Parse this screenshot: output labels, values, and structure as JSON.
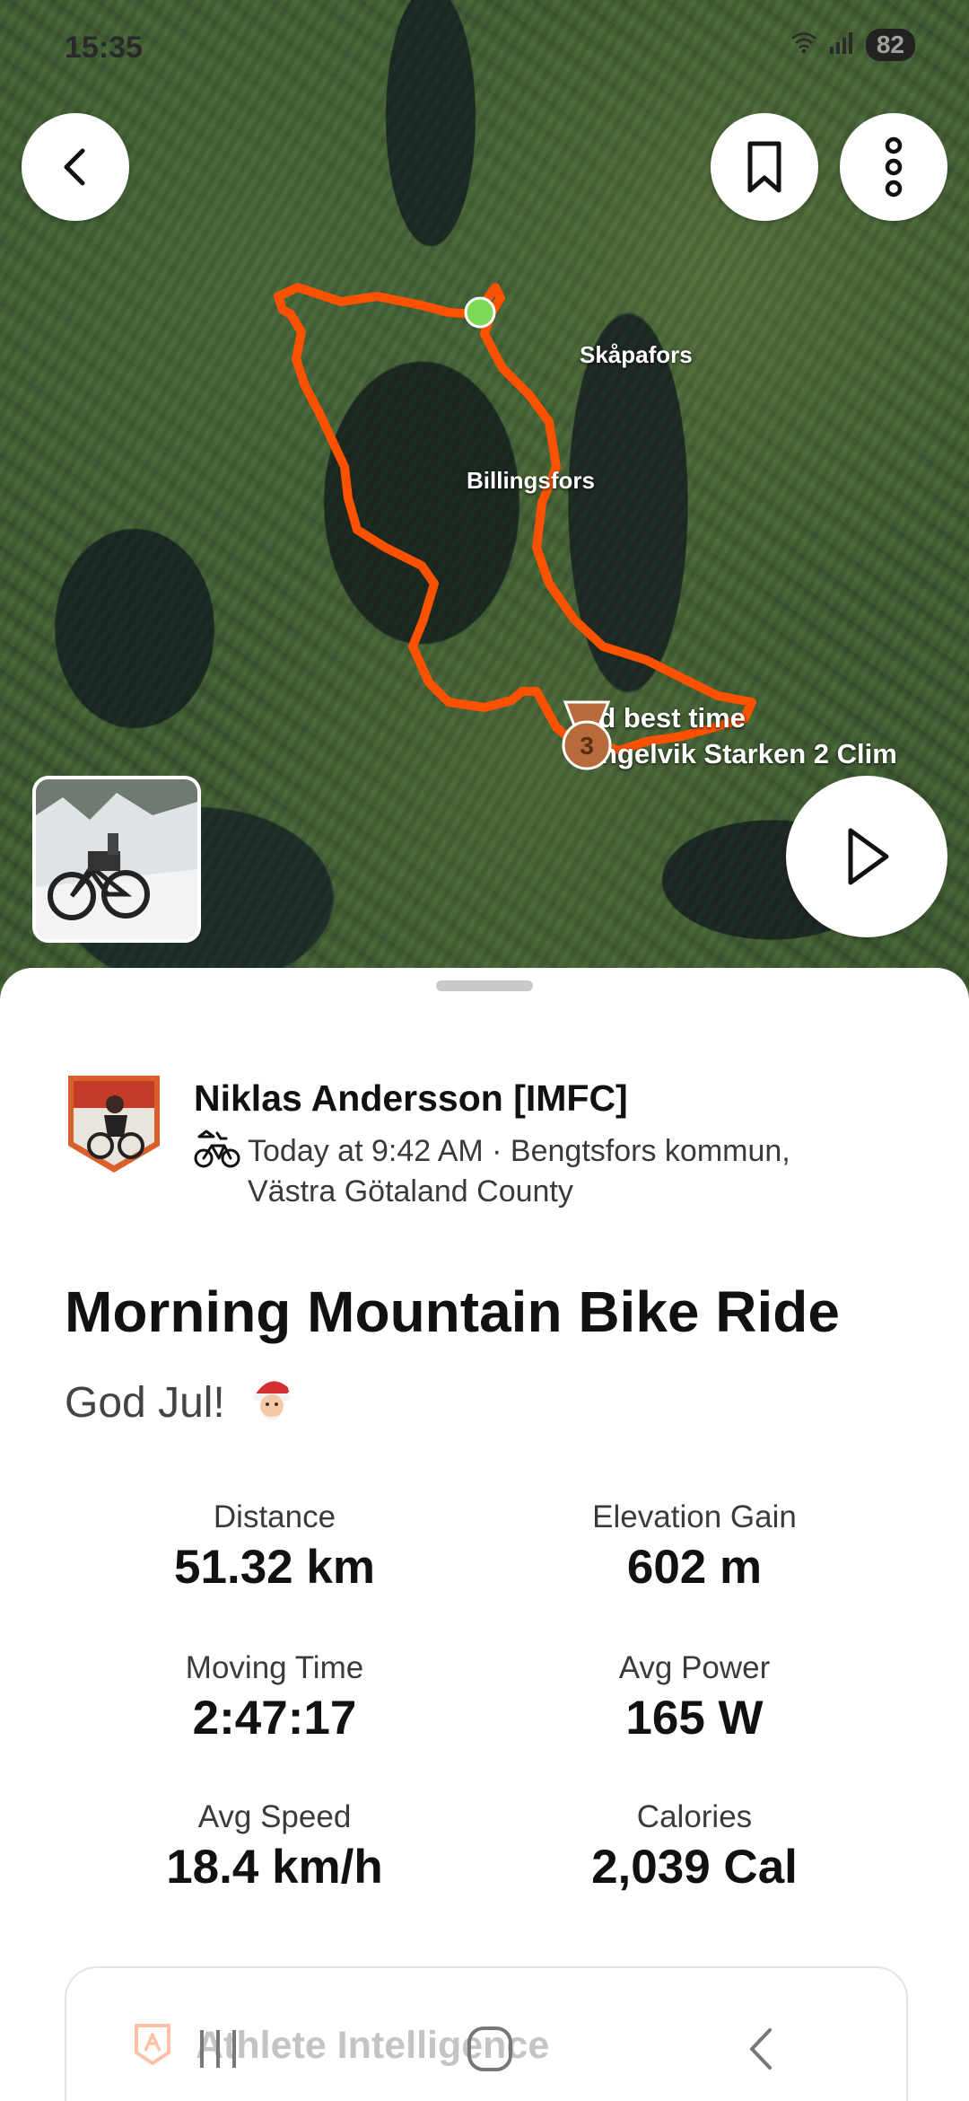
{
  "status_bar": {
    "time": "15:35",
    "battery": "82"
  },
  "map": {
    "place_labels": [
      "Skåpafors",
      "Billingsfors"
    ],
    "achievement": {
      "rank": "3",
      "line1": "3rd best time",
      "line2": "Dingelvik Starken 2 Clim"
    },
    "route_color": "#fc5200",
    "start_marker_color": "#7ed957"
  },
  "athlete": {
    "name": "Niklas Andersson [IMFC]",
    "meta": "Today at 9:42 AM · Bengtsfors kommun, Västra Götaland County",
    "activity_icon": "mountain-bike-icon"
  },
  "activity": {
    "title": "Morning Mountain Bike Ride",
    "description": "God Jul!"
  },
  "stats": [
    {
      "label": "Distance",
      "value": "51.32 km"
    },
    {
      "label": "Elevation Gain",
      "value": "602 m"
    },
    {
      "label": "Moving Time",
      "value": "2:47:17"
    },
    {
      "label": "Avg Power",
      "value": "165 W"
    },
    {
      "label": "Avg Speed",
      "value": "18.4 km/h"
    },
    {
      "label": "Calories",
      "value": "2,039 Cal"
    }
  ],
  "athlete_intelligence": {
    "label": "Athlete Intelligence"
  },
  "icons": {
    "back": "chevron-left-icon",
    "save": "bookmark-icon",
    "more": "more-vertical-icon",
    "play": "play-icon"
  }
}
